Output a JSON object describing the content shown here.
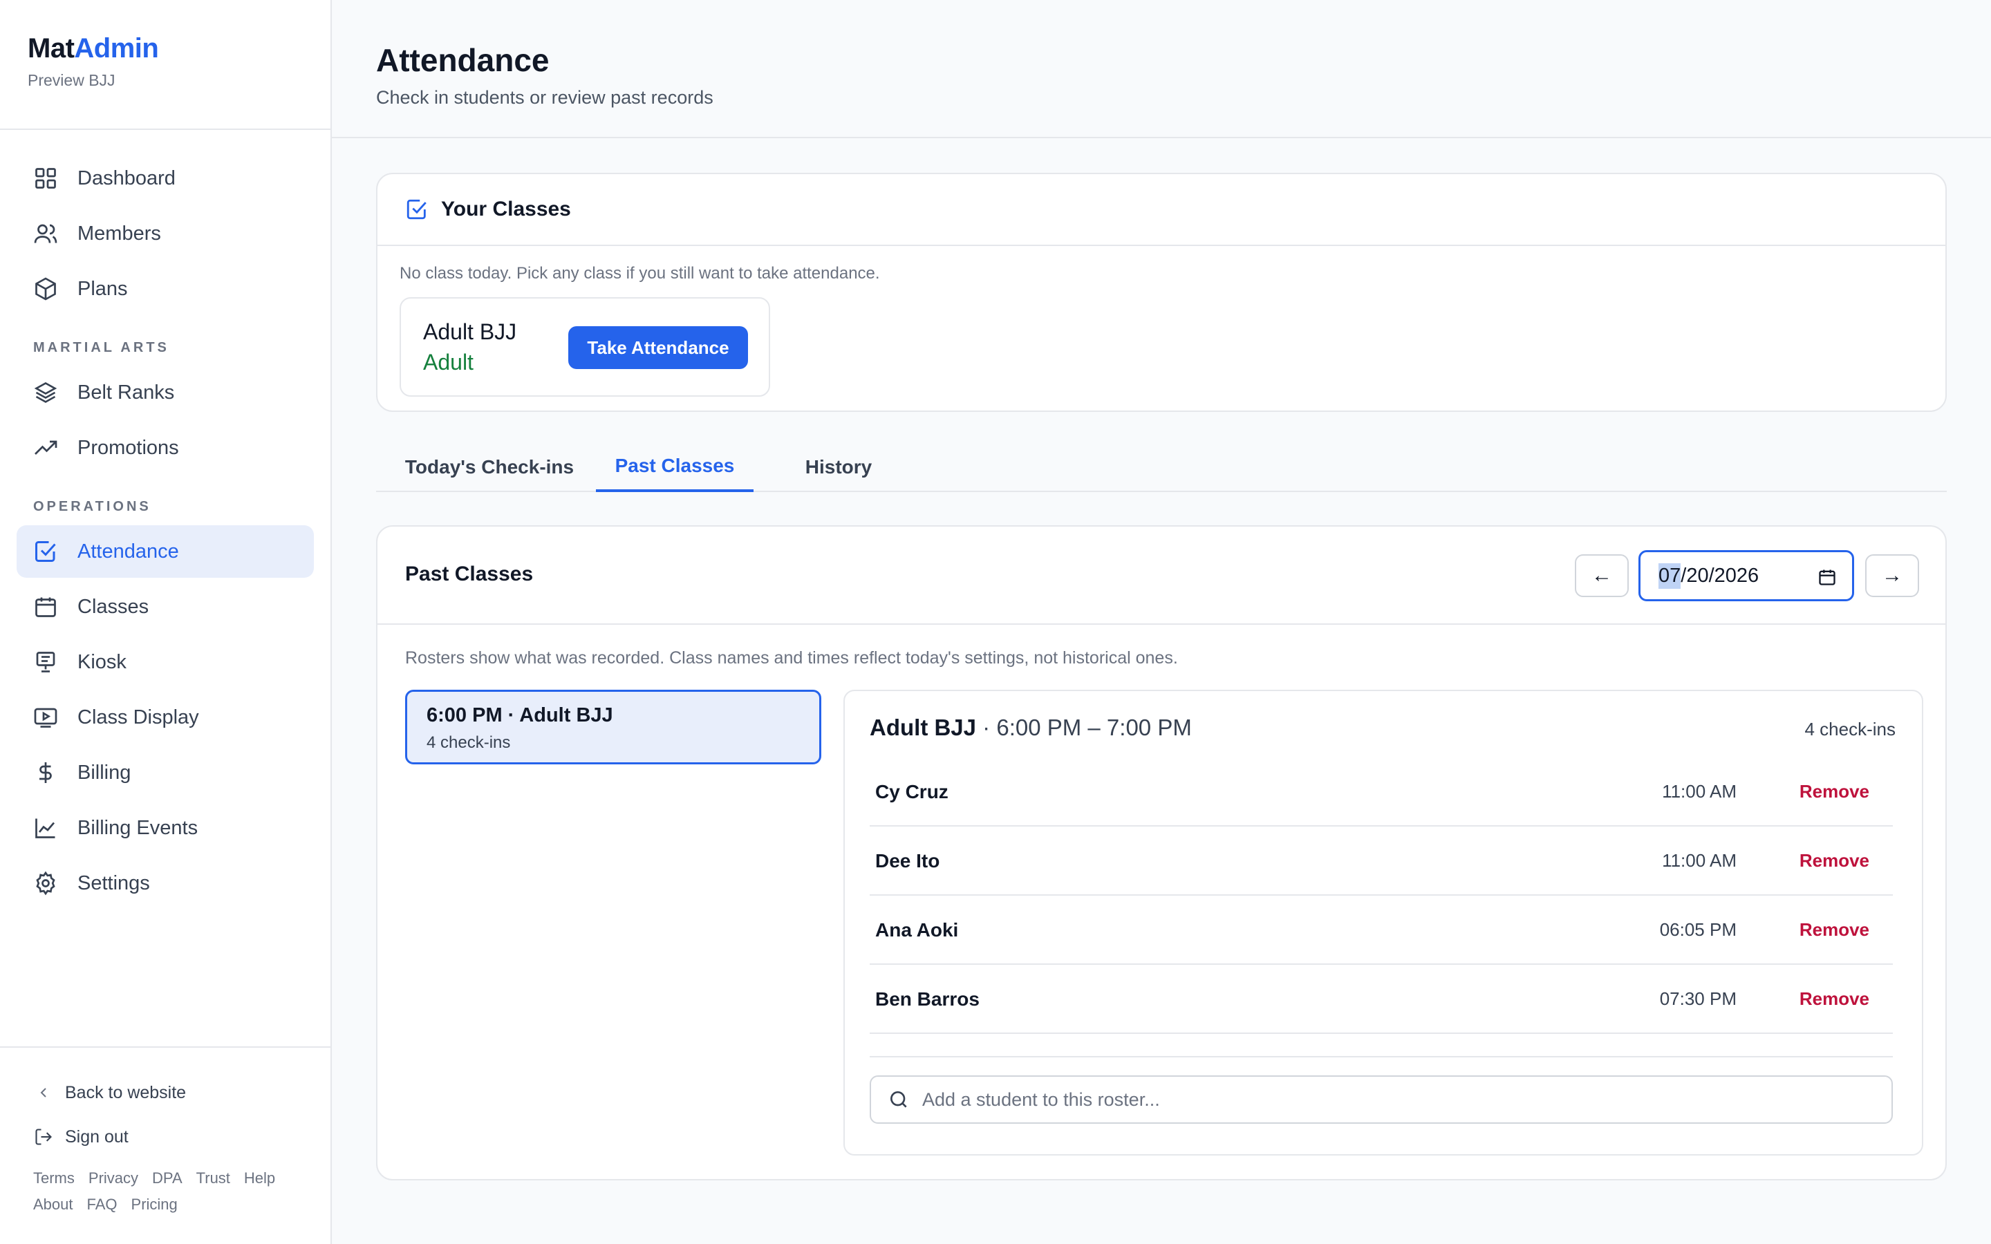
{
  "brand": {
    "name_part1": "Mat",
    "name_part2": "Admin",
    "subtitle": "Preview BJJ"
  },
  "sidebar": {
    "main_items": [
      {
        "label": "Dashboard",
        "icon": "grid-icon"
      },
      {
        "label": "Members",
        "icon": "users-icon"
      },
      {
        "label": "Plans",
        "icon": "box-icon"
      }
    ],
    "section_martial_arts": "MARTIAL ARTS",
    "martial_items": [
      {
        "label": "Belt Ranks",
        "icon": "layers-icon"
      },
      {
        "label": "Promotions",
        "icon": "trending-up-icon"
      }
    ],
    "section_operations": "OPERATIONS",
    "operations_items": [
      {
        "label": "Attendance",
        "icon": "check-square-icon",
        "active": true
      },
      {
        "label": "Classes",
        "icon": "calendar-icon"
      },
      {
        "label": "Kiosk",
        "icon": "kiosk-icon"
      },
      {
        "label": "Class Display",
        "icon": "display-icon"
      },
      {
        "label": "Billing",
        "icon": "dollar-icon"
      },
      {
        "label": "Billing Events",
        "icon": "chart-line-icon"
      },
      {
        "label": "Settings",
        "icon": "gear-icon"
      }
    ],
    "back_to_website": "Back to website",
    "sign_out": "Sign out",
    "footer_links_row1": [
      "Terms",
      "Privacy",
      "DPA",
      "Trust",
      "Help"
    ],
    "footer_links_row2": [
      "About",
      "FAQ",
      "Pricing"
    ]
  },
  "header": {
    "title": "Attendance",
    "subtitle": "Check in students or review past records"
  },
  "your_classes": {
    "title": "Your Classes",
    "note": "No class today. Pick any class if you still want to take attendance.",
    "class_name": "Adult BJJ",
    "class_level": "Adult",
    "take_button": "Take Attendance"
  },
  "tabs": [
    {
      "label": "Today's Check-ins",
      "active": false
    },
    {
      "label": "Past Classes",
      "active": true
    },
    {
      "label": "History",
      "active": false
    }
  ],
  "past_classes": {
    "title": "Past Classes",
    "prev_arrow": "←",
    "next_arrow": "→",
    "date_month": "07",
    "date_rest": "/20/2026",
    "note": "Rosters show what was recorded. Class names and times reflect today's settings, not historical ones.",
    "selected_class": {
      "title": "6:00 PM · Adult BJJ",
      "subtitle": "4 check-ins"
    },
    "roster": {
      "class_name": "Adult BJJ",
      "time_range": " · 6:00 PM – 7:00 PM",
      "count": "4 check-ins",
      "rows": [
        {
          "name": "Cy Cruz",
          "time": "11:00 AM",
          "action": "Remove"
        },
        {
          "name": "Dee Ito",
          "time": "11:00 AM",
          "action": "Remove"
        },
        {
          "name": "Ana Aoki",
          "time": "06:05 PM",
          "action": "Remove"
        },
        {
          "name": "Ben Barros",
          "time": "07:30 PM",
          "action": "Remove"
        }
      ],
      "add_placeholder": "Add a student to this roster..."
    }
  },
  "colors": {
    "accent": "#2563eb",
    "active_bg": "#e8eefb",
    "success": "#15803d",
    "danger": "#be123c"
  }
}
